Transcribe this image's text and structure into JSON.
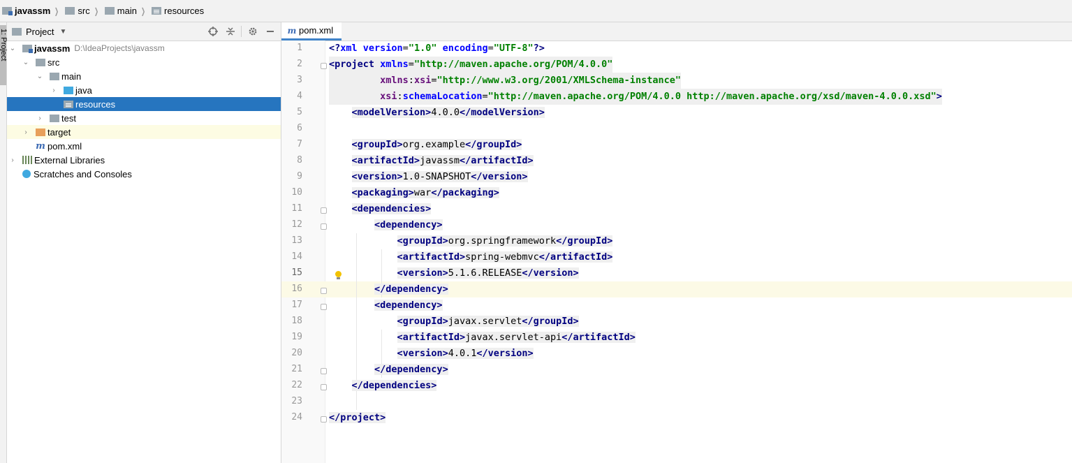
{
  "breadcrumb": {
    "items": [
      "javassm",
      "src",
      "main",
      "resources"
    ]
  },
  "side_tab": {
    "label": "1: Project"
  },
  "project_panel": {
    "title": "Project",
    "tree": [
      {
        "label": "javassm",
        "path": "D:\\IdeaProjects\\javassm"
      },
      {
        "label": "src"
      },
      {
        "label": "main"
      },
      {
        "label": "java"
      },
      {
        "label": "resources"
      },
      {
        "label": "test"
      },
      {
        "label": "target"
      },
      {
        "label": "pom.xml"
      },
      {
        "label": "External Libraries"
      },
      {
        "label": "Scratches and Consoles"
      }
    ]
  },
  "editor": {
    "tab_label": "pom.xml",
    "current_line": 15,
    "line_numbers": [
      "1",
      "2",
      "3",
      "4",
      "5",
      "6",
      "7",
      "8",
      "9",
      "10",
      "11",
      "12",
      "13",
      "14",
      "15",
      "16",
      "17",
      "18",
      "19",
      "20",
      "21",
      "22",
      "23",
      "24"
    ],
    "values": {
      "xml_version": "\"1.0\"",
      "xml_encoding": "\"UTF-8\"",
      "xmlns": "\"http://maven.apache.org/POM/4.0.0\"",
      "xmlns_xsi": "\"http://www.w3.org/2001/XMLSchema-instance\"",
      "schema_location": "\"http://maven.apache.org/POM/4.0.0 http://maven.apache.org/xsd/maven-4.0.0.xsd\"",
      "model_version": "4.0.0",
      "group_id": "org.example",
      "artifact_id": "javassm",
      "version": "1.0-SNAPSHOT",
      "packaging": "war",
      "dep1_group_id": "org.springframework",
      "dep1_artifact_id": "spring-webmvc",
      "dep1_version": "5.1.6.RELEASE",
      "dep2_group_id": "javax.servlet",
      "dep2_artifact_id": "javax.servlet-api",
      "dep2_version": "4.0.1"
    }
  }
}
